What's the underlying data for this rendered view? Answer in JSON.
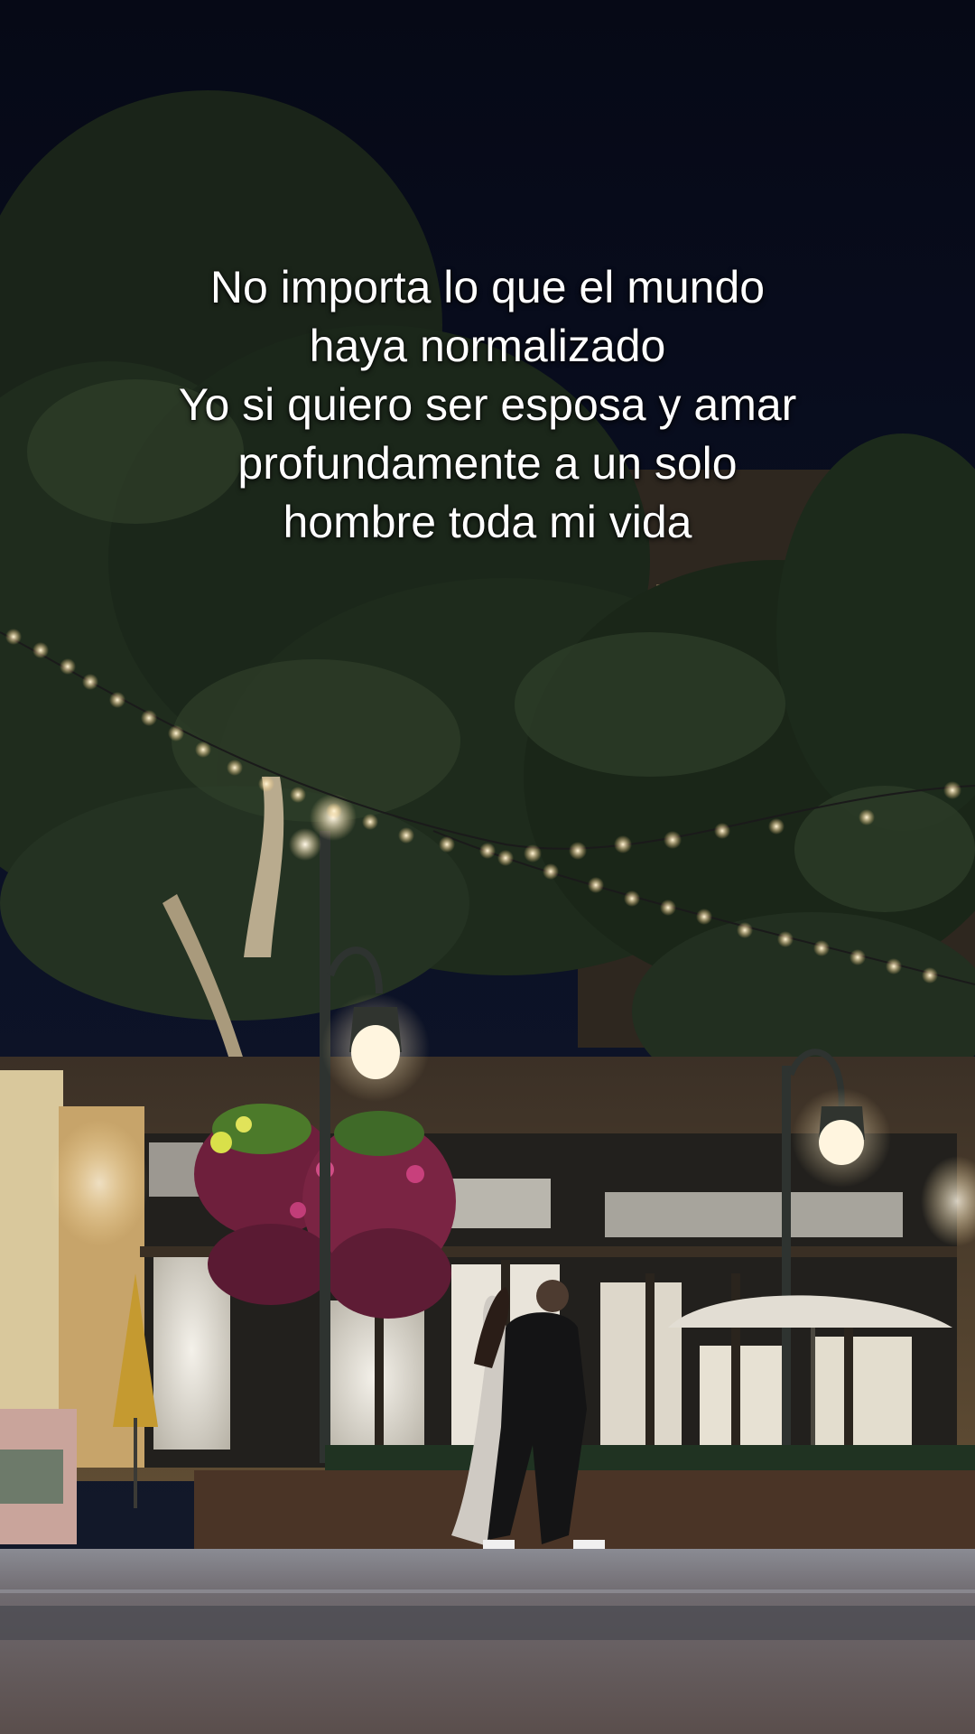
{
  "caption": {
    "lines": [
      "No importa lo que el mundo",
      "haya normalizado",
      "Yo si quiero ser esposa y amar",
      "profundamente a un solo",
      "hombre toda mi vida"
    ]
  },
  "scene": {
    "subject": "couple-embracing",
    "setting": "night-plaza"
  }
}
